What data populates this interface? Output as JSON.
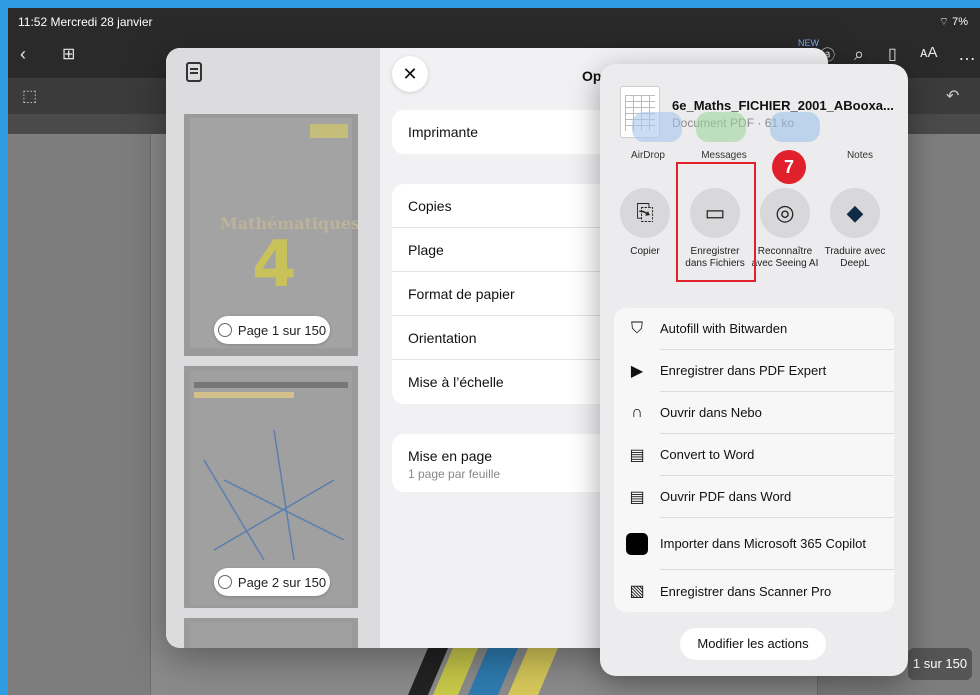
{
  "status_bar": {
    "time_date": "11:52  Mercredi 28 janvier",
    "battery": "7%"
  },
  "toolbar": {
    "new_badge": "NEW"
  },
  "doc": {
    "page_indicator": "1 sur 150"
  },
  "print_options": {
    "title": "Opti",
    "printer_label": "Imprimante",
    "rows": [
      "Copies",
      "Plage",
      "Format de papier",
      "Orientation",
      "Mise à l’échelle"
    ],
    "layout_label": "Mise en page",
    "layout_sub": "1 page par feuille",
    "thumb1": {
      "label": "Page 1 sur 150",
      "title_text": "Mathématiques"
    },
    "thumb2": {
      "label": "Page 2 sur 150"
    }
  },
  "share_sheet": {
    "file_name": "6e_Maths_FICHIER_2001_ABooxa...",
    "file_meta": "Document PDF · 61 ko",
    "apps": [
      "AirDrop",
      "Messages",
      "Notes"
    ],
    "actions": [
      {
        "label": "Copier"
      },
      {
        "label": "Enregistrer dans Fichiers"
      },
      {
        "label": "Reconnaître avec Seeing AI"
      },
      {
        "label": "Traduire avec DeepL"
      }
    ],
    "step_badge": "7",
    "list": [
      "Autofill with Bitwarden",
      "Enregistrer dans PDF Expert",
      "Ouvrir dans Nebo",
      "Convert to Word",
      "Ouvrir PDF dans Word",
      "Importer dans Microsoft 365 Copilot",
      "Enregistrer dans Scanner Pro"
    ],
    "modify_label": "Modifier les actions"
  },
  "colors": {
    "highlight": "#e0202a",
    "background": "#2f9be0"
  }
}
